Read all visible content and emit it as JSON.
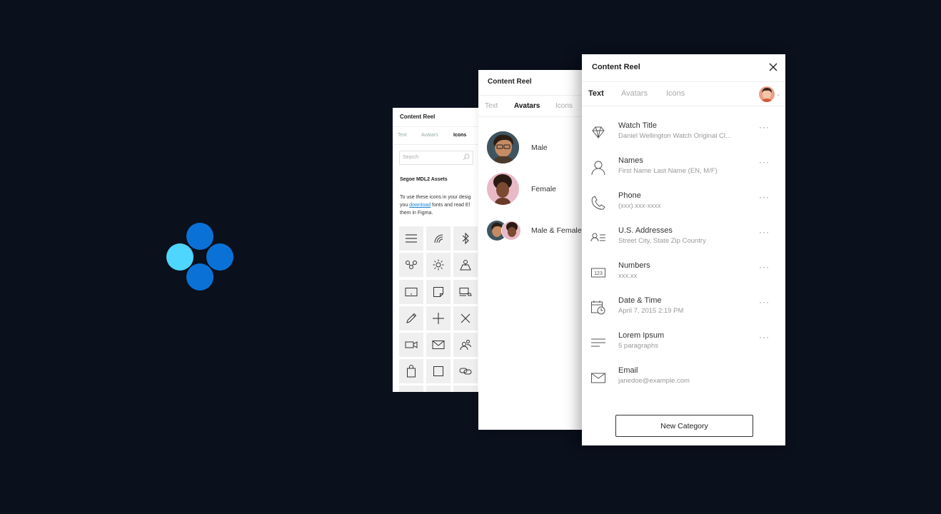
{
  "logo": {
    "name": "figma-plugin-logo"
  },
  "icons_panel": {
    "title": "Content Reel",
    "tabs": [
      "Text",
      "Avatars",
      "Icons"
    ],
    "active_tab": "Icons",
    "search_placeholder": "Search",
    "section_title": "Segoe MDL2 Assets",
    "desc_line1": "To use these icons in your desig",
    "desc_line2_pre": "you ",
    "desc_link": "download",
    "desc_line2_post": " fonts and read El",
    "desc_line3": "them in Figma.",
    "icons": [
      "menu-icon",
      "wifi-icon",
      "bluetooth-icon",
      "connect-icon",
      "brightness-icon",
      "map-icon",
      "tablet-icon",
      "note-icon",
      "sync-device-icon",
      "edit-icon",
      "add-icon",
      "cancel-icon",
      "video-icon",
      "mail-icon",
      "people-icon",
      "shopping-bag-icon",
      "stop-icon",
      "link-icon"
    ]
  },
  "avatars_panel": {
    "title": "Content Reel",
    "tabs": [
      "Text",
      "Avatars",
      "Icons"
    ],
    "active_tab": "Avatars",
    "items": [
      {
        "label": "Male"
      },
      {
        "label": "Female"
      },
      {
        "label": "Male & Female"
      }
    ]
  },
  "text_panel": {
    "title": "Content Reel",
    "tabs": [
      "Text",
      "Avatars",
      "Icons"
    ],
    "active_tab": "Text",
    "items": [
      {
        "name": "Watch Title",
        "sub": "Daniel Wellington Watch Original Cl...",
        "icon": "diamond-icon",
        "more": "···"
      },
      {
        "name": "Names",
        "sub": "First Name Last Name (EN, M/F)",
        "icon": "person-icon",
        "more": "···"
      },
      {
        "name": "Phone",
        "sub": "(xxx) xxx-xxxx",
        "icon": "phone-icon",
        "more": "···"
      },
      {
        "name": "U.S. Addresses",
        "sub": "Street City, State Zip Country",
        "icon": "contact-list-icon",
        "more": "···"
      },
      {
        "name": "Numbers",
        "sub": "xxx.xx",
        "icon": "numbers-icon",
        "more": "···"
      },
      {
        "name": "Date & Time",
        "sub": "April 7, 2015 2:19 PM",
        "icon": "calendar-clock-icon",
        "more": "···"
      },
      {
        "name": "Lorem Ipsum",
        "sub": "5 paragraphs",
        "icon": "paragraph-icon",
        "more": "···"
      },
      {
        "name": "Email",
        "sub": "janedoe@example.com",
        "icon": "mail-icon",
        "more": ""
      }
    ],
    "new_category_label": "New Category",
    "colors": {
      "accent": "#0a72d6",
      "logo_light": "#4fd6ff",
      "background": "#0a101c"
    }
  }
}
